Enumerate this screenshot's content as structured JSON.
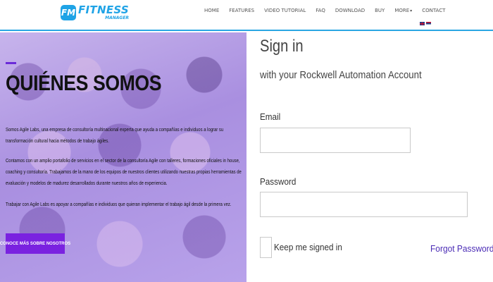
{
  "logo": {
    "badge": "FM",
    "name": "FITNESS",
    "sub": "MANAGER"
  },
  "nav": {
    "items": [
      "HOME",
      "FEATURES",
      "VIDEO TUTORIAL",
      "FAQ",
      "DOWNLOAD",
      "BUY",
      "MORE",
      "CONTACT"
    ],
    "more_caret": "▾"
  },
  "hero": {
    "title": "QUIÉNES SOMOS",
    "paragraphs": [
      "Somos Agile Labs, una empresa de consultoría multinacional experta que ayuda a compañías e individuos a lograr su transformación cultural hacia métodos de trabajo ágiles.",
      "Contamos con un amplio portafolio de servicios en el sector de la consultoría Agile con talleres, formaciones oficiales in house, coaching y consultoría. Trabajamos de la mano de los equipos de nuestros clientes utilizando nuestras propias herramientas de evaluación y modelos de madurez desarrollados durante nuestros años de experiencia.",
      "Trabajar con Agile Labs es apoyar a compañías e individuos que quieran implementar el trabajo ágil desde la primera vez."
    ],
    "button": "CONOCE MÁS SOBRE NOSOTROS"
  },
  "signin": {
    "title": "Sign in",
    "subtitle": "with your Rockwell Automation Account",
    "email_label": "Email",
    "email_value": "",
    "password_label": "Password",
    "password_value": "",
    "keep_signed_in": "Keep me signed in",
    "forgot": "Forgot Password?"
  },
  "colors": {
    "brand": "#1fa3e6",
    "accent_purple": "#7a22e0",
    "link": "#4a2bb5"
  }
}
